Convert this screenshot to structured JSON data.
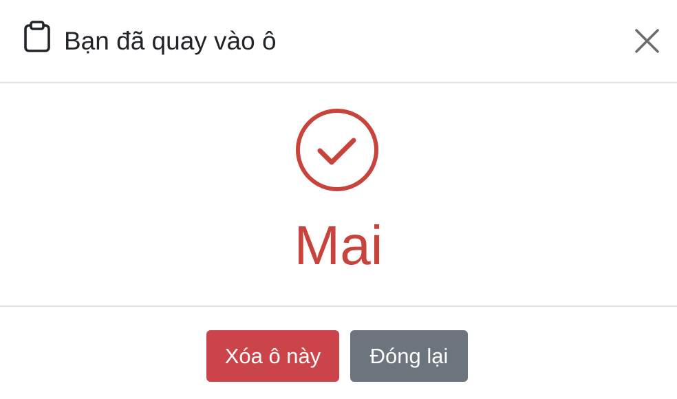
{
  "dialog": {
    "title": "Bạn đã quay vào ô",
    "title_icon": "clipboard-icon",
    "close_icon": "close-icon"
  },
  "result": {
    "icon": "check-circle-icon",
    "value": "Mai",
    "accent_color": "#c9433d"
  },
  "footer": {
    "delete_label": "Xóa ô này",
    "close_label": "Đóng lại",
    "delete_color": "#cb444a",
    "close_color": "#6c757d"
  }
}
